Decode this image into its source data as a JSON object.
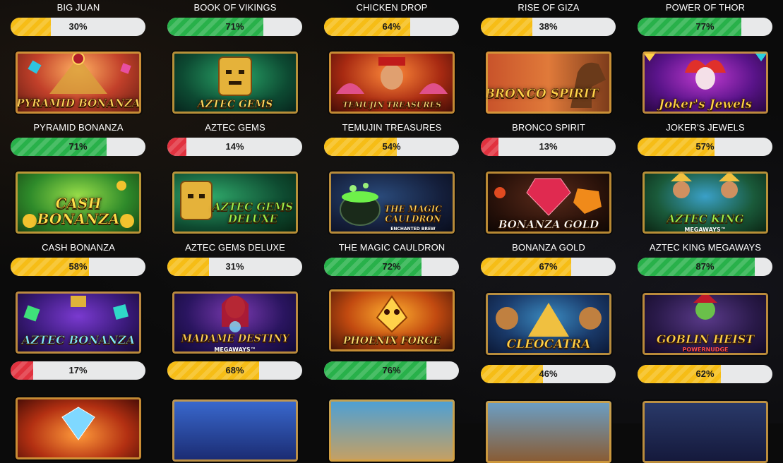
{
  "games": [
    [
      {
        "name": "BIG JUAN",
        "pct": "30%",
        "value": 30,
        "status": "yellow",
        "logo": "",
        "sub": "",
        "art": "none"
      },
      {
        "name": "PYRAMID BONANZA",
        "pct": "71%",
        "value": 71,
        "status": "green",
        "logo": "PYRAMID BONANZA",
        "sub": "",
        "art": "pyramid"
      },
      {
        "name": "CASH BONANZA",
        "pct": "58%",
        "value": 58,
        "status": "yellow",
        "logo": "CASH BONANZA",
        "sub": "",
        "art": "cash"
      },
      {
        "name": "",
        "pct": "17%",
        "value": 17,
        "status": "red",
        "logo": "AZTEC BONANZA",
        "sub": "",
        "art": "aztecbonanza"
      },
      {
        "name": "",
        "pct": "",
        "value": null,
        "status": "",
        "logo": "",
        "sub": "",
        "art": "diamond"
      }
    ],
    [
      {
        "name": "BOOK OF VIKINGS",
        "pct": "71%",
        "value": 71,
        "status": "green",
        "logo": "",
        "sub": "",
        "art": "none"
      },
      {
        "name": "AZTEC GEMS",
        "pct": "14%",
        "value": 14,
        "status": "red",
        "logo": "AZTEC GEMS",
        "sub": "",
        "art": "aztecgems"
      },
      {
        "name": "AZTEC GEMS DELUXE",
        "pct": "31%",
        "value": 31,
        "status": "yellow",
        "logo": "AZTEC GEMS DELUXE",
        "sub": "",
        "art": "aztecdeluxe"
      },
      {
        "name": "",
        "pct": "68%",
        "value": 68,
        "status": "yellow",
        "logo": "MADAME DESTINY",
        "sub": "MEGAWAYS™",
        "art": "madame"
      },
      {
        "name": "",
        "pct": "",
        "value": null,
        "status": "",
        "logo": "",
        "sub": "",
        "art": "blue"
      }
    ],
    [
      {
        "name": "CHICKEN DROP",
        "pct": "64%",
        "value": 64,
        "status": "yellow",
        "logo": "",
        "sub": "",
        "art": "none"
      },
      {
        "name": "TEMUJIN TREASURES",
        "pct": "54%",
        "value": 54,
        "status": "yellow",
        "logo": "TEMUJIN TREASURES",
        "sub": "",
        "art": "temujin"
      },
      {
        "name": "THE MAGIC CAULDRON",
        "pct": "72%",
        "value": 72,
        "status": "green",
        "logo": "THE MAGIC CAULDRON",
        "sub": "ENCHANTED BREW",
        "art": "cauldron"
      },
      {
        "name": "",
        "pct": "76%",
        "value": 76,
        "status": "green",
        "logo": "PHOENIX FORGE",
        "sub": "",
        "art": "phoenix"
      },
      {
        "name": "",
        "pct": "",
        "value": null,
        "status": "",
        "logo": "",
        "sub": "",
        "art": "egypt"
      }
    ],
    [
      {
        "name": "RISE OF GIZA",
        "pct": "38%",
        "value": 38,
        "status": "yellow",
        "logo": "",
        "sub": "",
        "art": "none"
      },
      {
        "name": "BRONCO SPIRIT",
        "pct": "13%",
        "value": 13,
        "status": "red",
        "logo": "BRONCO SPIRIT",
        "sub": "",
        "art": "bronco"
      },
      {
        "name": "BONANZA GOLD",
        "pct": "67%",
        "value": 67,
        "status": "yellow",
        "logo": "BONANZA GOLD",
        "sub": "",
        "art": "bonanzagold"
      },
      {
        "name": "",
        "pct": "46%",
        "value": 46,
        "status": "yellow",
        "logo": "CLEOCATRA",
        "sub": "",
        "art": "cleocatra"
      },
      {
        "name": "",
        "pct": "",
        "value": null,
        "status": "",
        "logo": "",
        "sub": "",
        "art": "west"
      }
    ],
    [
      {
        "name": "POWER OF THOR",
        "pct": "77%",
        "value": 77,
        "status": "green",
        "logo": "",
        "sub": "",
        "art": "none"
      },
      {
        "name": "JOKER'S JEWELS",
        "pct": "57%",
        "value": 57,
        "status": "yellow",
        "logo": "Joker's Jewels",
        "sub": "",
        "art": "joker"
      },
      {
        "name": "AZTEC KING MEGAWAYS",
        "pct": "87%",
        "value": 87,
        "status": "green",
        "logo": "AZTEC KING",
        "sub": "MEGAWAYS™",
        "art": "aztecking"
      },
      {
        "name": "",
        "pct": "62%",
        "value": 62,
        "status": "yellow",
        "logo": "GOBLIN HEIST",
        "sub": "POWERNUDGE",
        "art": "goblin"
      },
      {
        "name": "",
        "pct": "",
        "value": null,
        "status": "",
        "logo": "",
        "sub": "",
        "art": "police"
      }
    ]
  ]
}
